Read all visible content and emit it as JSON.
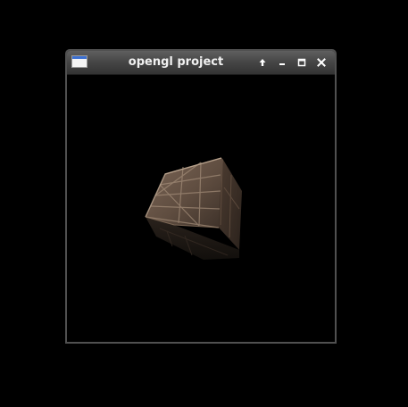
{
  "window": {
    "title": "opengl project",
    "app_icon": "window-icon",
    "buttons": [
      {
        "name": "shade-button",
        "icon": "arrow-up-icon"
      },
      {
        "name": "minimize-button",
        "icon": "minimize-icon"
      },
      {
        "name": "maximize-button",
        "icon": "maximize-icon"
      },
      {
        "name": "close-button",
        "icon": "close-icon"
      }
    ]
  },
  "scene": {
    "object": "textured-crate-cube",
    "background_color": "#000000",
    "texture_colors": [
      "#6e5a4c",
      "#4d3d32",
      "#2d241f",
      "#1d1815"
    ]
  }
}
